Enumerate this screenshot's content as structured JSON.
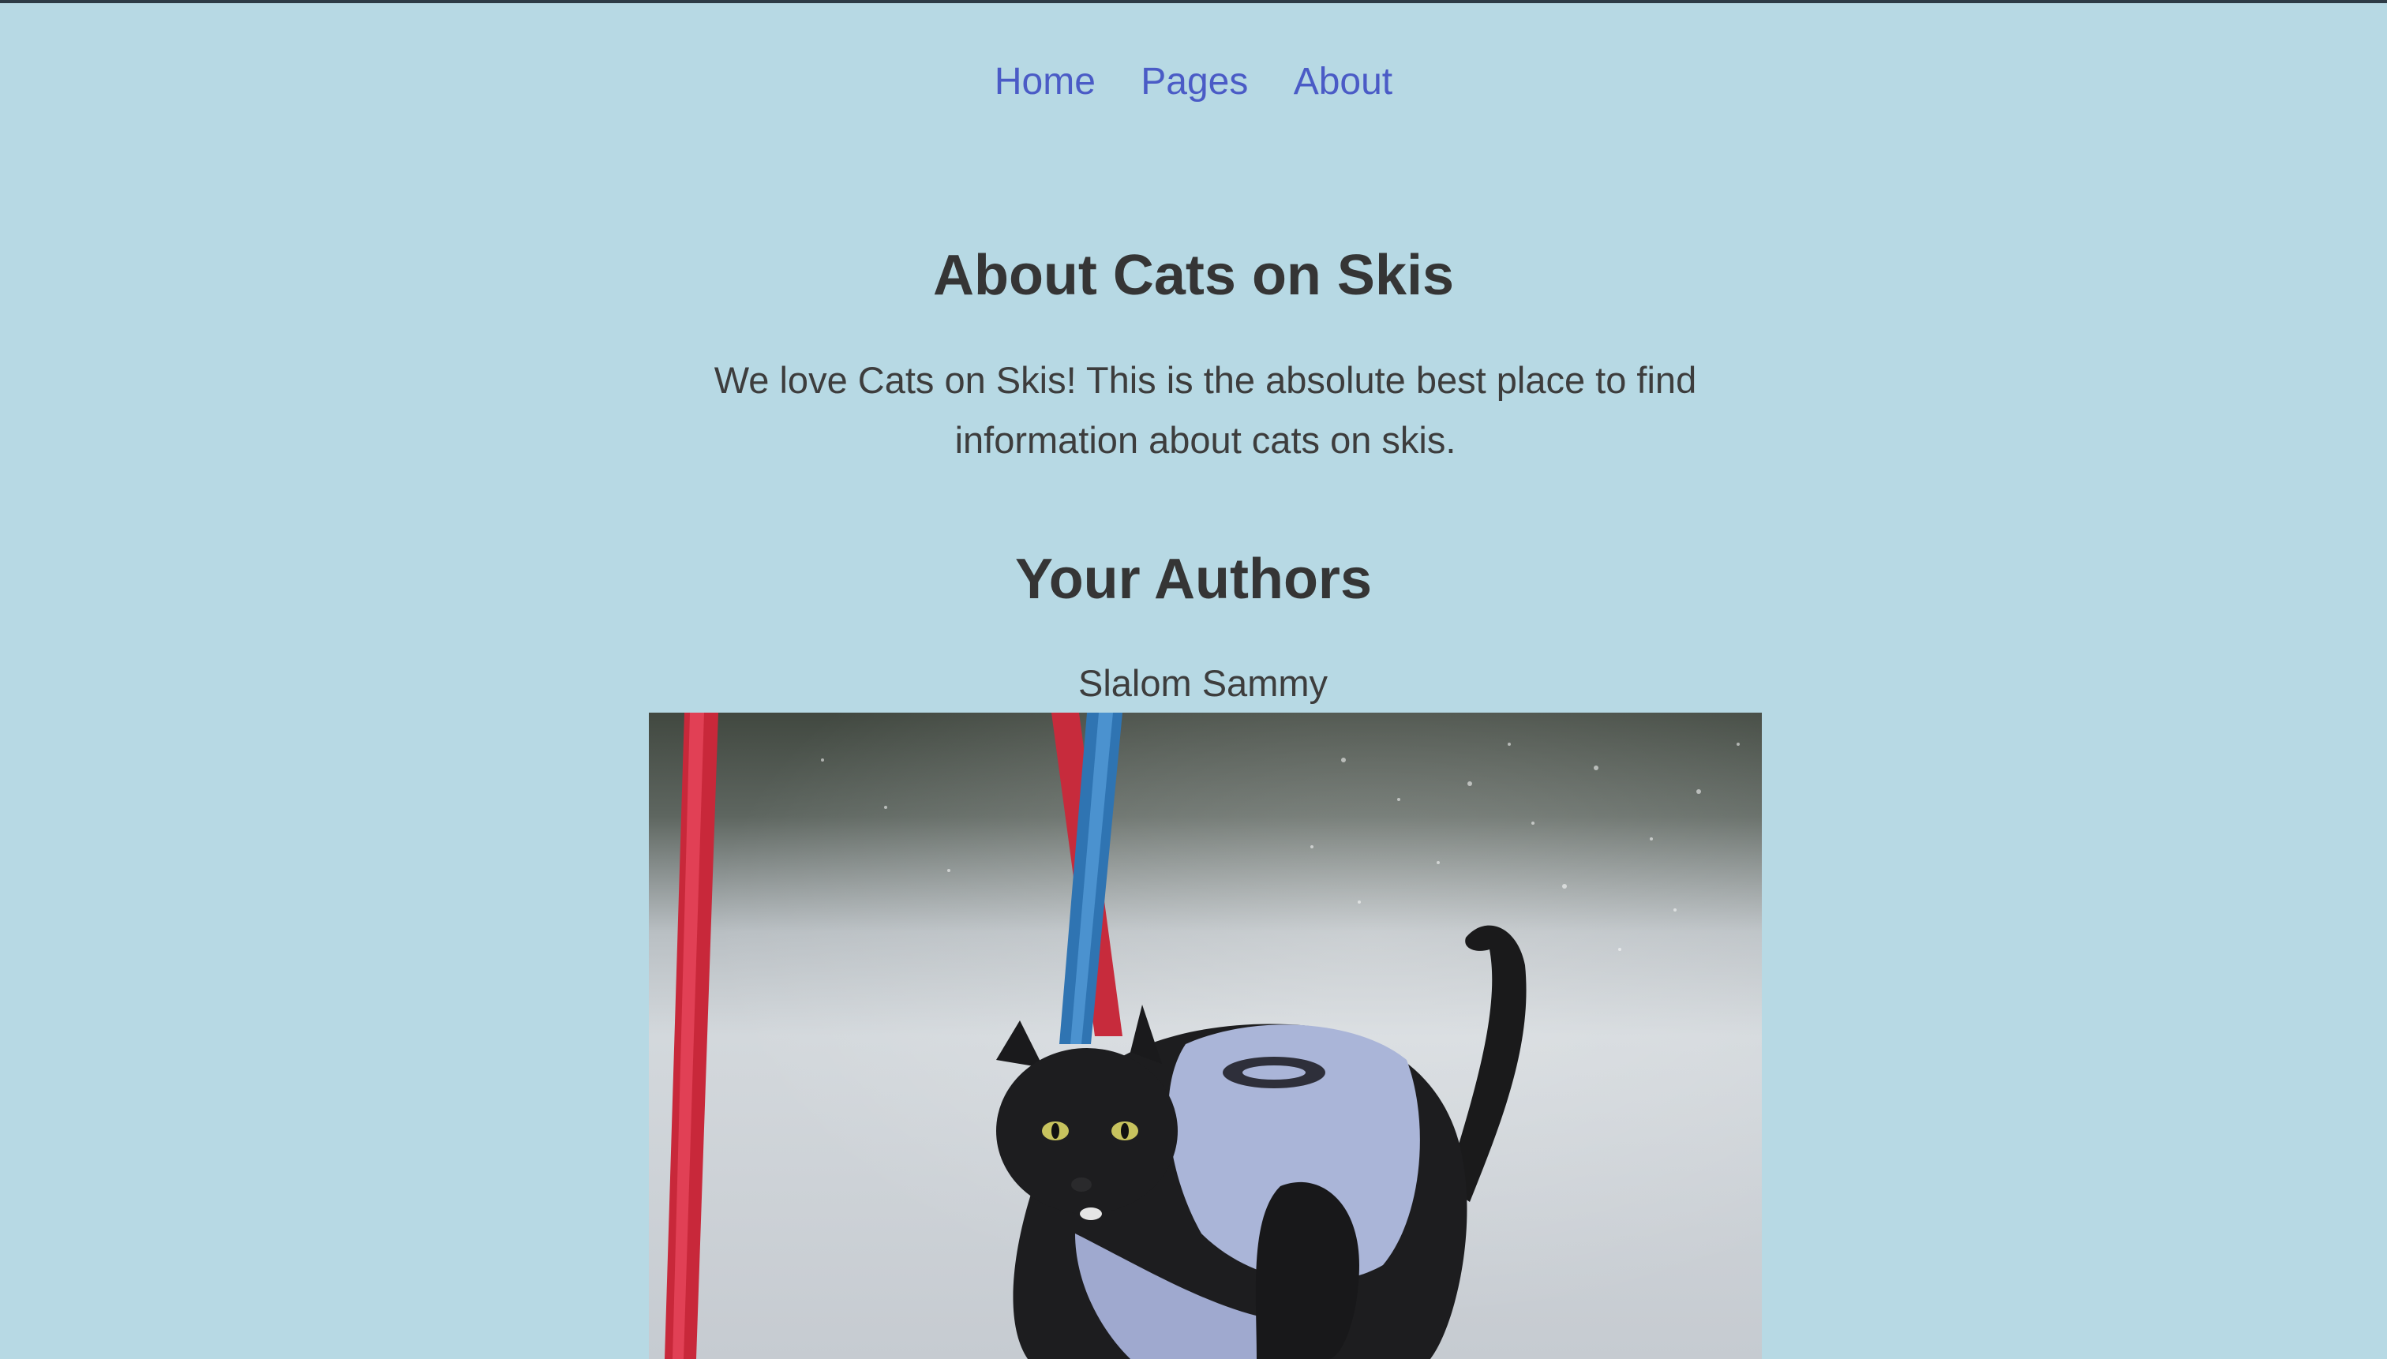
{
  "nav": {
    "items": [
      {
        "label": "Home"
      },
      {
        "label": "Pages"
      },
      {
        "label": "About"
      }
    ]
  },
  "page": {
    "title": "About Cats on Skis",
    "intro": "We love Cats on Skis! This is the absolute best place to find information about cats on skis."
  },
  "authors": {
    "heading": "Your Authors",
    "list": [
      {
        "name": "Slalom Sammy",
        "photo": "black-cat-skiing-photo"
      }
    ]
  },
  "colors": {
    "background": "#b7d9e4",
    "link": "#4a5bc6",
    "text": "#353535",
    "top_border": "#2d3b46"
  }
}
